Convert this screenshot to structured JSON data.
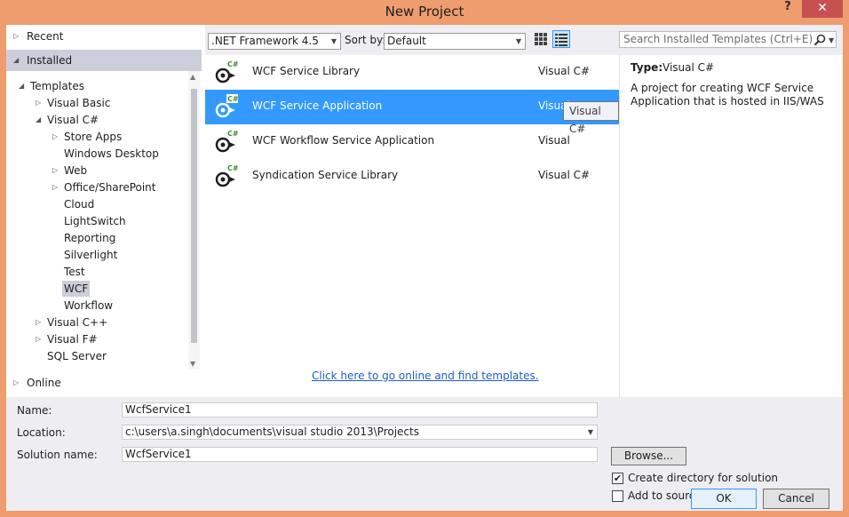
{
  "window": {
    "title": "New Project",
    "help_label": "?",
    "close_label": "✕"
  },
  "left": {
    "recent_label": "Recent",
    "installed_label": "Installed",
    "online_label": "Online",
    "tree": [
      {
        "label": "Templates",
        "level": 0,
        "expander": "expanded"
      },
      {
        "label": "Visual Basic",
        "level": 1,
        "expander": "collapsed"
      },
      {
        "label": "Visual C#",
        "level": 1,
        "expander": "expanded"
      },
      {
        "label": "Store Apps",
        "level": 2,
        "expander": "collapsed"
      },
      {
        "label": "Windows Desktop",
        "level": 2,
        "expander": "none"
      },
      {
        "label": "Web",
        "level": 2,
        "expander": "collapsed"
      },
      {
        "label": "Office/SharePoint",
        "level": 2,
        "expander": "collapsed"
      },
      {
        "label": "Cloud",
        "level": 2,
        "expander": "none"
      },
      {
        "label": "LightSwitch",
        "level": 2,
        "expander": "none"
      },
      {
        "label": "Reporting",
        "level": 2,
        "expander": "none"
      },
      {
        "label": "Silverlight",
        "level": 2,
        "expander": "none"
      },
      {
        "label": "Test",
        "level": 2,
        "expander": "none"
      },
      {
        "label": "WCF",
        "level": 2,
        "expander": "none",
        "selected": true
      },
      {
        "label": "Workflow",
        "level": 2,
        "expander": "none"
      },
      {
        "label": "Visual C++",
        "level": 1,
        "expander": "collapsed"
      },
      {
        "label": "Visual F#",
        "level": 1,
        "expander": "collapsed"
      },
      {
        "label": "SQL Server",
        "level": 1,
        "expander": "none"
      }
    ]
  },
  "toolbar": {
    "framework": ".NET Framework 4.5",
    "sort_by_label": "Sort by:",
    "sort_value": "Default",
    "search_placeholder": "Search Installed Templates (Ctrl+E)"
  },
  "templates": [
    {
      "name": "WCF Service Library",
      "language": "Visual C#",
      "selected": false
    },
    {
      "name": "WCF Service Application",
      "language": "Visual C#",
      "selected": true
    },
    {
      "name": "WCF Workflow Service Application",
      "language": "Visual",
      "selected": false
    },
    {
      "name": "Syndication Service Library",
      "language": "Visual C#",
      "selected": false
    }
  ],
  "tooltip": "Visual C#",
  "online_link": "Click here to go online and find templates.",
  "detail": {
    "type_label": "Type:",
    "type_value": "Visual C#",
    "description": "A project for creating WCF Service Application that is hosted in IIS/WAS"
  },
  "form": {
    "name_label": "Name:",
    "name_value": "WcfService1",
    "location_label": "Location:",
    "location_value": "c:\\users\\a.singh\\documents\\visual studio 2013\\Projects",
    "solution_label": "Solution name:",
    "solution_value": "WcfService1",
    "browse_label": "Browse...",
    "create_dir_label": "Create directory for solution",
    "create_dir_checked": true,
    "source_control_label": "Add to source control",
    "source_control_checked": false,
    "ok_label": "OK",
    "cancel_label": "Cancel"
  },
  "colors": {
    "chrome": "#ef9d6f",
    "selection": "#3399ff",
    "tree_selection": "#cccedb",
    "link": "#1e5ec8"
  },
  "icons": {
    "template": "wcf-csharp-icon",
    "search": "search-icon",
    "view_grid": "grid-view-icon",
    "view_list": "list-view-icon"
  }
}
